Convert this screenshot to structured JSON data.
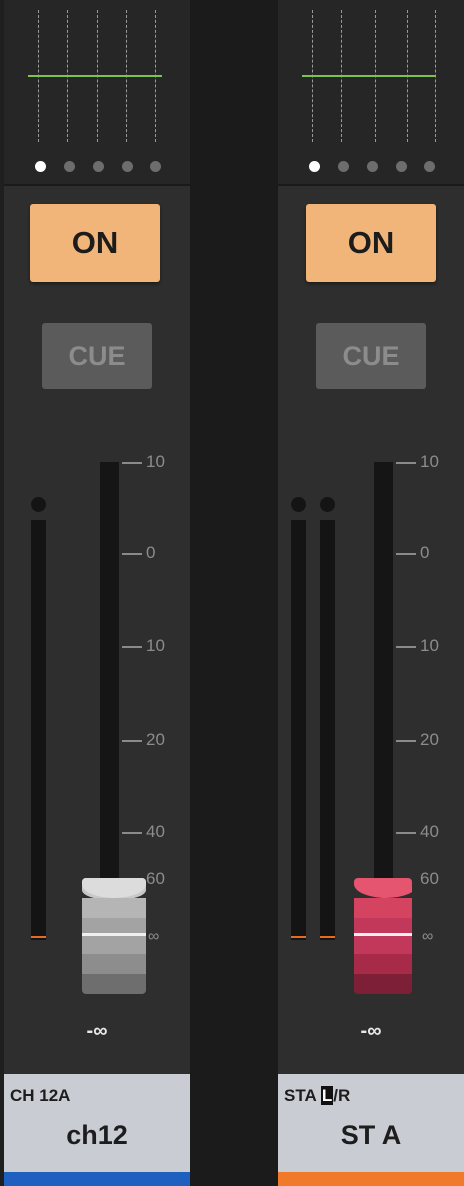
{
  "channels": [
    {
      "id_label": "CH 12A",
      "name": "ch12",
      "on_label": "ON",
      "cue_label": "CUE",
      "fader_value": "-∞",
      "color_bar": "#1f5fbf",
      "fader_color": "grey",
      "meters": 1,
      "eq_page_dots": 5,
      "eq_active_dot": 1
    },
    {
      "id_label": "STA",
      "id_highlight": "L",
      "id_suffix": "/R",
      "name": "ST A",
      "on_label": "ON",
      "cue_label": "CUE",
      "fader_value": "-∞",
      "color_bar": "#f07a2a",
      "fader_color": "red",
      "meters": 2,
      "eq_page_dots": 5,
      "eq_active_dot": 1
    }
  ],
  "scale_labels": [
    "10",
    "0",
    "10",
    "20",
    "40",
    "60",
    "∞"
  ],
  "colors": {
    "on_button": "#f2b579",
    "cue_button": "#5b5b5b",
    "eq_curve": "#7cc44c",
    "meter_peak": "#e86a1f",
    "name_panel": "#c9ccd3"
  }
}
